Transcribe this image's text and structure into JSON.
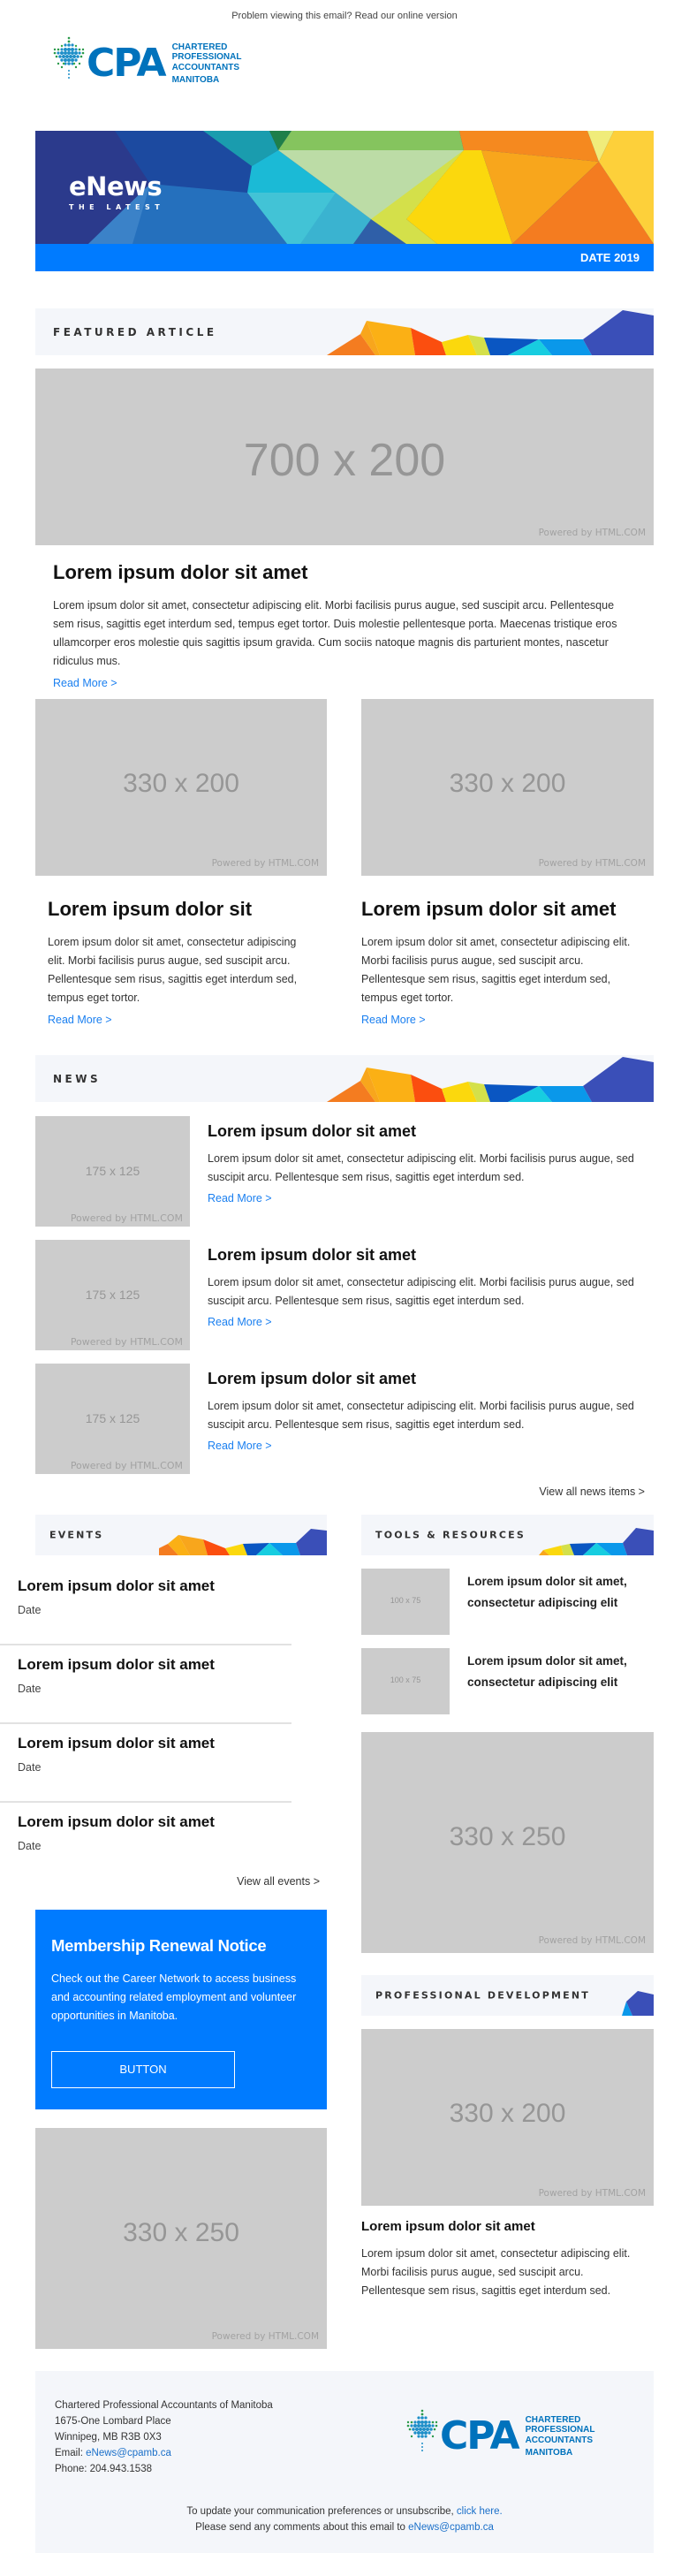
{
  "preheader": {
    "text": "Problem viewing this email? Read our online version"
  },
  "logo": {
    "mark": "CPA",
    "line1": "CHARTERED",
    "line2": "PROFESSIONAL",
    "line3": "ACCOUNTANTS",
    "line4": "MANITOBA"
  },
  "banner": {
    "title": "eNews",
    "subtitle": "THE LATEST",
    "date": "DATE 2019"
  },
  "featured": {
    "heading": "FEATURED ARTICLE",
    "image": {
      "dimensions": "700 x 200",
      "credit": "Powered by HTML.COM"
    },
    "title": "Lorem ipsum dolor sit amet",
    "body": "Lorem ipsum dolor sit amet, consectetur adipiscing elit. Morbi facilisis purus augue, sed suscipit arcu. Pellentesque sem risus, sagittis eget interdum sed, tempus eget tortor. Duis molestie pellentesque porta. Maecenas tristique eros ullamcorper eros molestie quis sagittis ipsum gravida. Cum sociis natoque magnis dis parturient montes, nascetur ridiculus mus.",
    "read_more": "Read More >",
    "columns": [
      {
        "image": {
          "dimensions": "330 x 200",
          "credit": "Powered by HTML.COM"
        },
        "title": "Lorem ipsum dolor sit",
        "body": "Lorem ipsum dolor sit amet, consectetur adipiscing elit. Morbi facilisis purus augue, sed suscipit arcu. Pellentesque sem risus, sagittis eget interdum sed, tempus eget tortor.",
        "read_more": "Read More >"
      },
      {
        "image": {
          "dimensions": "330 x 200",
          "credit": "Powered by HTML.COM"
        },
        "title": "Lorem ipsum dolor sit amet",
        "body": "Lorem ipsum dolor sit amet, consectetur adipiscing elit. Morbi facilisis purus augue, sed suscipit arcu. Pellentesque sem risus, sagittis eget interdum sed, tempus eget tortor.",
        "read_more": "Read More >"
      }
    ]
  },
  "news": {
    "heading": "NEWS",
    "items": [
      {
        "image": {
          "dimensions": "175 x 125",
          "credit": "Powered by HTML.COM"
        },
        "title": "Lorem ipsum dolor sit amet",
        "body": "Lorem ipsum dolor sit amet, consectetur adipiscing elit. Morbi facilisis purus augue, sed suscipit arcu. Pellentesque sem risus, sagittis eget interdum sed.",
        "read_more": "Read More >"
      },
      {
        "image": {
          "dimensions": "175 x 125",
          "credit": "Powered by HTML.COM"
        },
        "title": "Lorem ipsum dolor sit amet",
        "body": "Lorem ipsum dolor sit amet, consectetur adipiscing elit. Morbi facilisis purus augue, sed suscipit arcu. Pellentesque sem risus, sagittis eget interdum sed.",
        "read_more": "Read More >"
      },
      {
        "image": {
          "dimensions": "175 x 125",
          "credit": "Powered by HTML.COM"
        },
        "title": "Lorem ipsum dolor sit amet",
        "body": "Lorem ipsum dolor sit amet, consectetur adipiscing elit. Morbi facilisis purus augue, sed suscipit arcu. Pellentesque sem risus, sagittis eget interdum sed.",
        "read_more": "Read More >"
      }
    ],
    "view_all": "View all news items >"
  },
  "events": {
    "heading": "EVENTS",
    "items": [
      {
        "title": "Lorem ipsum dolor sit amet",
        "date": "Date"
      },
      {
        "title": "Lorem ipsum dolor sit amet",
        "date": "Date"
      },
      {
        "title": "Lorem ipsum dolor sit amet",
        "date": "Date"
      },
      {
        "title": "Lorem ipsum dolor sit amet",
        "date": "Date"
      }
    ],
    "view_all": "View all events >"
  },
  "notice": {
    "title": "Membership Renewal Notice",
    "body": "Check out the Career Network to access business and accounting related employment and volunteer opportunities in Manitoba.",
    "button": "BUTTON"
  },
  "left_ad": {
    "dimensions": "330 x 250",
    "credit": "Powered by HTML.COM"
  },
  "tools": {
    "heading": "TOOLS & RESOURCES",
    "items": [
      {
        "image": {
          "dimensions": "100 x 75"
        },
        "title": "Lorem ipsum dolor sit amet, consectetur adipiscing elit"
      },
      {
        "image": {
          "dimensions": "100 x 75"
        },
        "title": "Lorem ipsum dolor sit amet, consectetur adipiscing elit"
      }
    ],
    "ad": {
      "dimensions": "330 x 250",
      "credit": "Powered by HTML.COM"
    }
  },
  "pd": {
    "heading": "PROFESSIONAL DEVELOPMENT",
    "image": {
      "dimensions": "330 x 200",
      "credit": "Powered by HTML.COM"
    },
    "title": "Lorem ipsum dolor sit amet",
    "body": "Lorem ipsum dolor sit amet, consectetur adipiscing elit. Morbi facilisis purus augue, sed suscipit arcu. Pellentesque sem risus, sagittis eget interdum sed."
  },
  "footer": {
    "org": "Chartered Professional Accountants of Manitoba",
    "address1": "1675-One Lombard Place",
    "address2": "Winnipeg, MB R3B 0X3",
    "email_label": "Email: ",
    "email": "eNews@cpamb.ca",
    "phone": "Phone: 204.943.1538",
    "prefs_text": "To update your communication preferences or unsubscribe, ",
    "prefs_link": "click here",
    "prefs_end": ".",
    "comments_text": "Please send any comments about this email to ",
    "comments_email": "eNews@cpamb.ca"
  },
  "colors": {
    "brand_blue": "#007bff",
    "logo_blue": "#0072bc",
    "link_blue": "#1a7ff0",
    "placeholder_gray": "#cccccc",
    "section_bg": "#f4f6fa"
  }
}
